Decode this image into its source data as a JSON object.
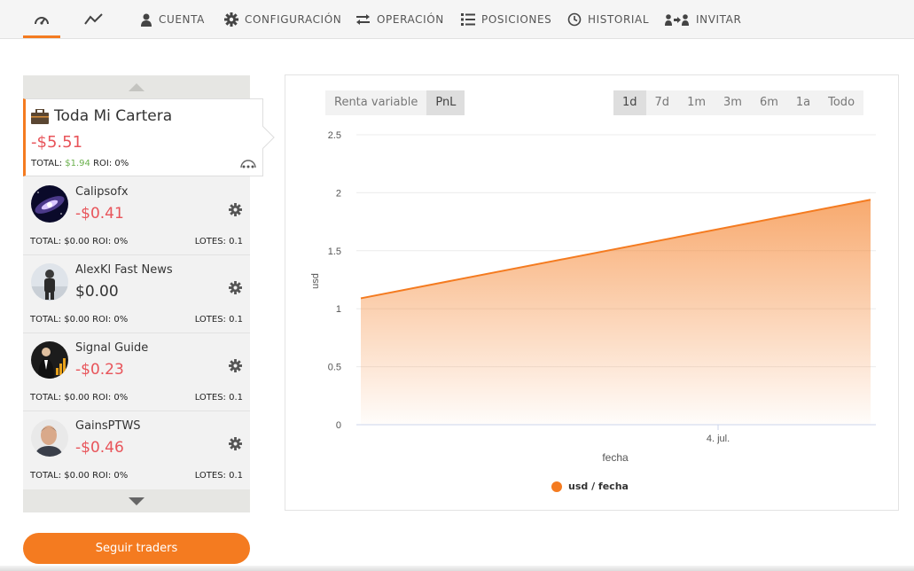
{
  "nav": {
    "items": [
      {
        "label": "",
        "icon": "dashboard-icon"
      },
      {
        "label": "",
        "icon": "line-chart-icon"
      },
      {
        "label": "CUENTA",
        "icon": "user-icon"
      },
      {
        "label": "CONFIGURACIÓN",
        "icon": "gear-icon"
      },
      {
        "label": "OPERACIÓN",
        "icon": "swap-arrows-icon"
      },
      {
        "label": "POSICIONES",
        "icon": "list-icon"
      },
      {
        "label": "HISTORIAL",
        "icon": "clock-icon"
      },
      {
        "label": "INVITAR",
        "icon": "invite-users-icon"
      }
    ],
    "active_index": 0,
    "accent": "#f47b20"
  },
  "portfolio": {
    "title": "Toda Mi Cartera",
    "value": "-$5.51",
    "total_label": "TOTAL:",
    "total_value": "$1.94",
    "roi": "ROI: 0%"
  },
  "traders": [
    {
      "name": "Calipsofx",
      "value": "-$0.41",
      "negative": true,
      "stats": "TOTAL: $0.00 ROI: 0%",
      "lots": "LOTES: 0.1"
    },
    {
      "name": "AlexKl Fast News",
      "value": "$0.00",
      "negative": false,
      "stats": "TOTAL: $0.00 ROI: 0%",
      "lots": "LOTES: 0.1"
    },
    {
      "name": "Signal Guide",
      "value": "-$0.23",
      "negative": true,
      "stats": "TOTAL: $0.00 ROI: 0%",
      "lots": "LOTES: 0.1"
    },
    {
      "name": "GainsPTWS",
      "value": "-$0.46",
      "negative": true,
      "stats": "TOTAL: $0.00 ROI: 0%",
      "lots": "LOTES: 0.1"
    }
  ],
  "follow_button": "Seguir traders",
  "chart": {
    "type_tabs": [
      "Renta variable",
      "PnL"
    ],
    "type_active": 1,
    "range_tabs": [
      "1d",
      "7d",
      "1m",
      "3m",
      "6m",
      "1a",
      "Todo"
    ],
    "range_active": 0
  },
  "chart_data": {
    "type": "area",
    "x": [
      "start",
      "end"
    ],
    "x_tick": "4. jul.",
    "values": [
      1.09,
      1.94
    ],
    "ylim": [
      0,
      2.5
    ],
    "yticks": [
      "0",
      "0.5",
      "1",
      "1.5",
      "2",
      "2.5"
    ],
    "ylabel": "usd",
    "xlabel": "fecha",
    "series_name": "usd / fecha",
    "color": "#f47b20"
  }
}
